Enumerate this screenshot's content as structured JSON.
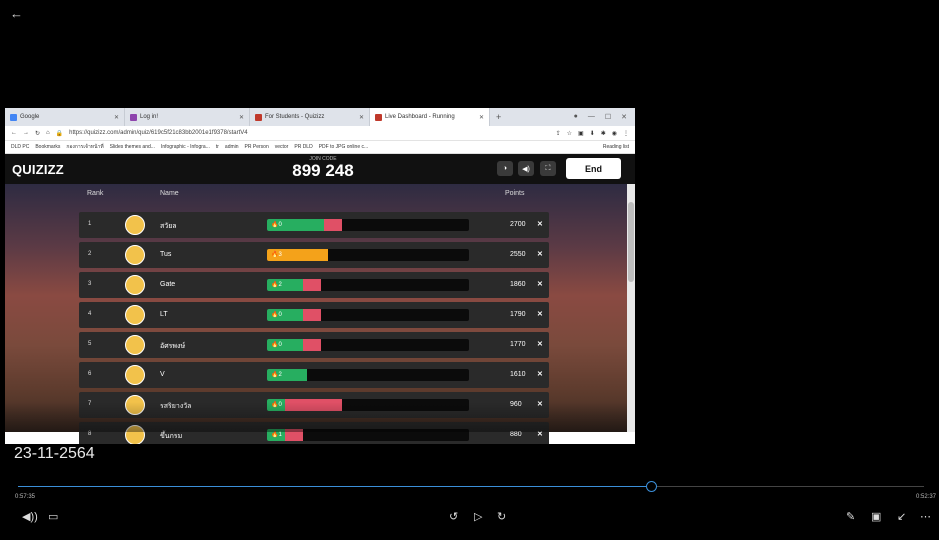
{
  "player": {
    "back_icon": "←",
    "date_caption": "23-11-2564",
    "current_time": "0:57:35",
    "duration": "0:52:37",
    "progress": 0.698
  },
  "browser": {
    "tabs": [
      {
        "label": "Google",
        "color": "#4285f4"
      },
      {
        "label": "Log in!",
        "color": "#8e44ad"
      },
      {
        "label": "For Students - Quizizz",
        "color": "#c0392b"
      },
      {
        "label": "Live Dashboard - Running",
        "color": "#c0392b",
        "active": true
      }
    ],
    "url": "https://quizizz.com/admin/quiz/619c5f21c83bb2001e1f9378/startV4",
    "bookmarks": [
      "DLD PC",
      "Bookmarks",
      "กองการเจ้าหน้าที่",
      "Slides themes and...",
      "Infographic - Infogra...",
      "tr",
      "admin",
      "PR Person",
      "vector",
      "PR DLD",
      "PDF to JPG online c...",
      "Reading list"
    ]
  },
  "quiz": {
    "logo": "QUIZIZZ",
    "join_label": "JOIN CODE",
    "join_code": "899 248",
    "end_label": "End",
    "col_rank": "Rank",
    "col_name": "Name",
    "col_points": "Points",
    "rows": [
      {
        "rank": "1",
        "name": "สวัยล",
        "streak": "0",
        "correct": 0.28,
        "wrong": 0.09,
        "points": "2700"
      },
      {
        "rank": "2",
        "name": "Tus",
        "streak": "3",
        "correct": 0.3,
        "wrong": 0,
        "orange": true,
        "points": "2550"
      },
      {
        "rank": "3",
        "name": "Gate",
        "streak": "2",
        "correct": 0.18,
        "wrong": 0.09,
        "points": "1860"
      },
      {
        "rank": "4",
        "name": "LT",
        "streak": "0",
        "correct": 0.18,
        "wrong": 0.09,
        "points": "1790"
      },
      {
        "rank": "5",
        "name": "อัศรพงษ์",
        "streak": "0",
        "correct": 0.18,
        "wrong": 0.09,
        "points": "1770"
      },
      {
        "rank": "6",
        "name": "V",
        "streak": "2",
        "correct": 0.2,
        "wrong": 0,
        "points": "1610"
      },
      {
        "rank": "7",
        "name": "รสริยางวัล",
        "streak": "0",
        "correct": 0.09,
        "wrong": 0.28,
        "points": "960"
      },
      {
        "rank": "8",
        "name": "ขึ้นกรม",
        "streak": "1",
        "correct": 0.09,
        "wrong": 0.09,
        "points": "880"
      }
    ]
  }
}
